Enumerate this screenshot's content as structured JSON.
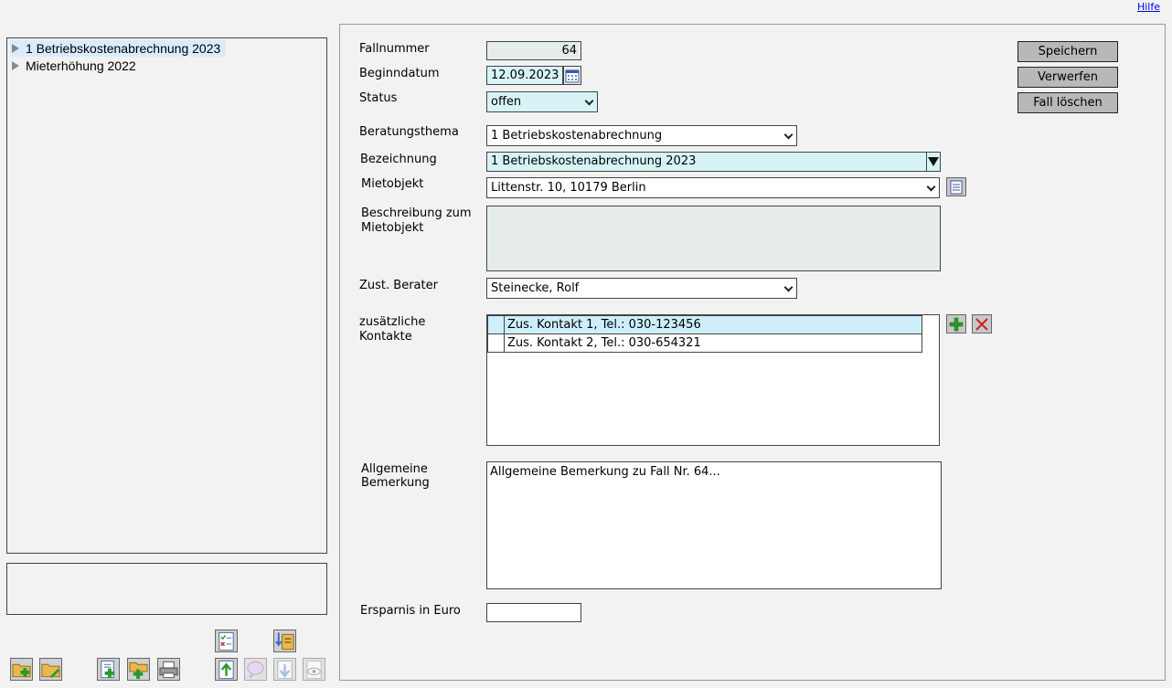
{
  "header": {
    "help_link": "Hilfe"
  },
  "tree": {
    "items": [
      {
        "label": "1 Betriebskostenabrechnung 2023",
        "selected": true
      },
      {
        "label": "Mieterhöhung 2022",
        "selected": false
      }
    ]
  },
  "toolbar": {
    "buttons": [
      {
        "name": "new-folder-button",
        "icon": "folder-plus-icon",
        "enabled": true
      },
      {
        "name": "edit-folder-button",
        "icon": "folder-edit-icon",
        "enabled": true
      },
      {
        "name": "new-document-button",
        "icon": "document-plus-icon",
        "enabled": true
      },
      {
        "name": "new-subfolder-button",
        "icon": "folder-add-icon",
        "enabled": true
      },
      {
        "name": "print-button",
        "icon": "printer-icon",
        "enabled": true
      },
      {
        "name": "checklist-button",
        "icon": "checklist-icon",
        "enabled": true
      },
      {
        "name": "import-button",
        "icon": "import-icon",
        "enabled": true
      },
      {
        "name": "upload-button",
        "icon": "upload-icon",
        "enabled": true
      },
      {
        "name": "comment-button",
        "icon": "speech-bubble-icon",
        "enabled": false
      },
      {
        "name": "download-button",
        "icon": "download-icon",
        "enabled": false
      },
      {
        "name": "preview-button",
        "icon": "eye-icon",
        "enabled": false
      }
    ]
  },
  "form": {
    "fallnummer": {
      "label": "Fallnummer",
      "value": "64"
    },
    "beginndatum": {
      "label": "Beginndatum",
      "value": "12.09.2023"
    },
    "status": {
      "label": "Status",
      "value": "offen"
    },
    "beratungsthema": {
      "label": "Beratungsthema",
      "value": "1 Betriebskostenabrechnung"
    },
    "bezeichnung": {
      "label": "Bezeichnung",
      "value": "1 Betriebskostenabrechnung 2023"
    },
    "mietobjekt": {
      "label": "Mietobjekt",
      "value": "Littenstr. 10, 10179 Berlin"
    },
    "beschreibung": {
      "label_line1": "Beschreibung zum",
      "label_line2": "Mietobjekt",
      "value": ""
    },
    "berater": {
      "label": "Zust. Berater",
      "value": "Steinecke, Rolf"
    },
    "kontakte": {
      "label_line1": "zusätzliche",
      "label_line2": "Kontakte",
      "rows": [
        {
          "text": "Zus. Kontakt 1, Tel.: 030-123456",
          "selected": true
        },
        {
          "text": "Zus. Kontakt 2, Tel.: 030-654321",
          "selected": false
        }
      ]
    },
    "bemerkung": {
      "label_line1": "Allgemeine",
      "label_line2": "Bemerkung",
      "value": "Allgemeine Bemerkung zu Fall Nr. 64..."
    },
    "ersparnis": {
      "label": "Ersparnis in Euro",
      "value": ""
    }
  },
  "actions": {
    "save": "Speichern",
    "discard": "Verwerfen",
    "delete": "Fall löschen"
  },
  "colors": {
    "field_cyan": "#d6f4f6",
    "tree_selection": "#d8ecff",
    "button_gray": "#b8b8b8"
  }
}
